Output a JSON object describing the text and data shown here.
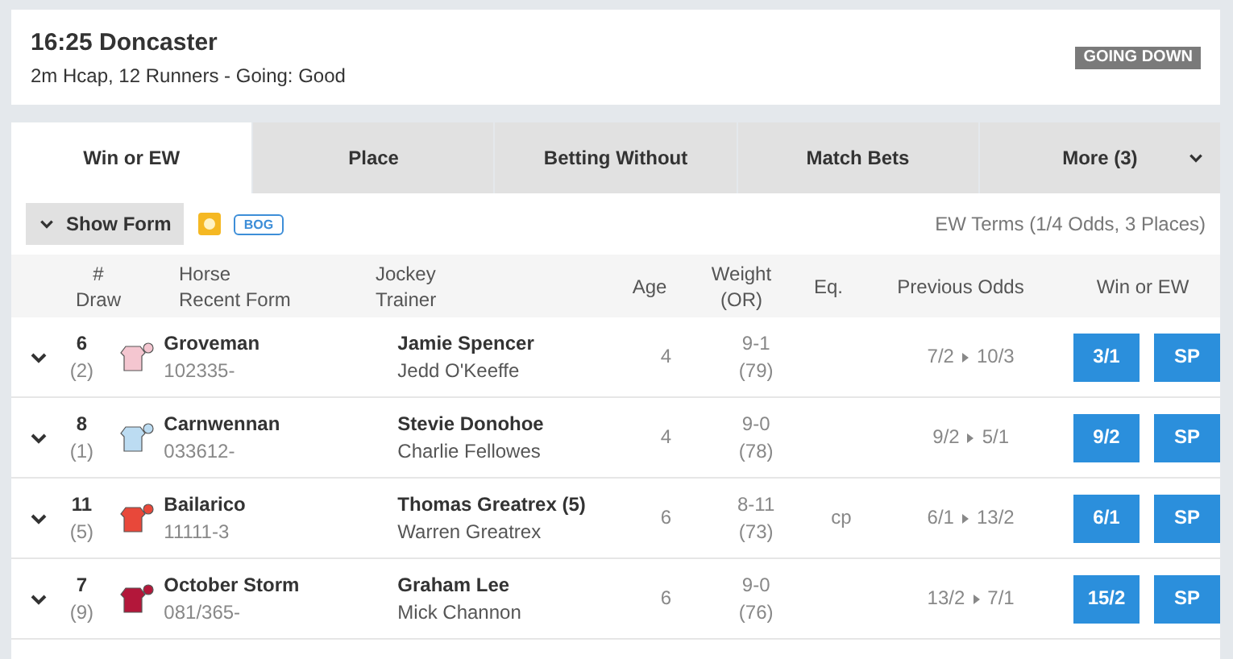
{
  "race": {
    "title": "16:25 Doncaster",
    "subtitle": "2m Hcap, 12 Runners - Going: Good",
    "status": "GOING DOWN"
  },
  "tabs": [
    {
      "label": "Win or EW",
      "selected": true
    },
    {
      "label": "Place",
      "selected": false
    },
    {
      "label": "Betting Without",
      "selected": false
    },
    {
      "label": "Match Bets",
      "selected": false
    },
    {
      "label": "More (3)",
      "selected": false,
      "kind": "dropdown"
    }
  ],
  "toolbar": {
    "show_form": "Show Form",
    "badge": "BOG",
    "ew_terms": "EW Terms (1/4 Odds, 3 Places)"
  },
  "table": {
    "columns": [
      {
        "lines": [
          "#",
          "Draw"
        ]
      },
      {
        "lines": [
          "Horse",
          "Recent Form"
        ]
      },
      {
        "lines": [
          "Jockey",
          "Trainer"
        ]
      },
      {
        "lines": [
          "Age"
        ]
      },
      {
        "lines": [
          "Weight",
          "(OR)"
        ]
      },
      {
        "lines": [
          "Eq."
        ]
      },
      {
        "lines": [
          "Previous Odds"
        ]
      },
      {
        "lines": [
          "Win or EW"
        ]
      }
    ],
    "rows": [
      {
        "number": "6",
        "draw": "(2)",
        "color": "#f4c6d0",
        "horse": "Groveman",
        "form": "102335-",
        "jockey": "Jamie Spencer",
        "trainer": "Jedd O'Keeffe",
        "age": "4",
        "weight": "9-1",
        "rating": "(79)",
        "eq": "",
        "odds_from": "7/2",
        "odds_to": "10/3",
        "price": "3/1",
        "sp": "SP"
      },
      {
        "number": "8",
        "draw": "(1)",
        "color": "#bcdcf2",
        "horse": "Carnwennan",
        "form": "033612-",
        "jockey": "Stevie Donohoe",
        "trainer": "Charlie Fellowes",
        "age": "4",
        "weight": "9-0",
        "rating": "(78)",
        "eq": "",
        "odds_from": "9/2",
        "odds_to": "5/1",
        "price": "9/2",
        "sp": "SP"
      },
      {
        "number": "11",
        "draw": "(5)",
        "color": "#e8483a",
        "horse": "Bailarico",
        "form": "11111-3",
        "jockey": "Thomas Greatrex (5)",
        "trainer": "Warren Greatrex",
        "age": "6",
        "weight": "8-11",
        "rating": "(73)",
        "eq": "cp",
        "odds_from": "6/1",
        "odds_to": "13/2",
        "price": "6/1",
        "sp": "SP"
      },
      {
        "number": "7",
        "draw": "(9)",
        "color": "#b3173a",
        "horse": "October Storm",
        "form": "081/365-",
        "jockey": "Graham Lee",
        "trainer": "Mick Channon",
        "age": "6",
        "weight": "9-0",
        "rating": "(76)",
        "eq": "",
        "odds_from": "13/2",
        "odds_to": "7/1",
        "price": "15/2",
        "sp": "SP"
      }
    ]
  }
}
